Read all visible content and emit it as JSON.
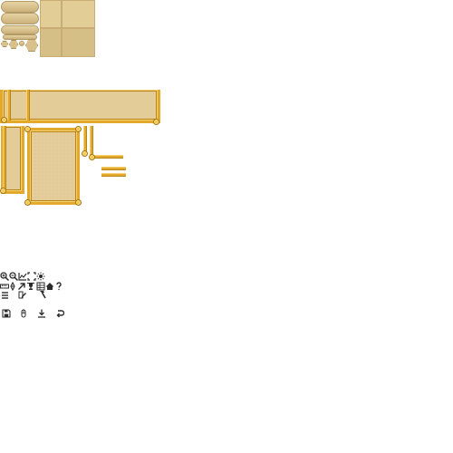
{
  "sheet": {
    "background": "#ffffff"
  },
  "palette": {
    "parchment": "#e3cc98",
    "parchment_dark": "#d6bf86",
    "gold": "#e2a92c",
    "gold_highlight": "#f5d372",
    "gold_shadow": "#b98417",
    "icon": "#2b2b2b"
  },
  "swatches": {
    "pills": 4,
    "hexes": 3,
    "tiles": [
      "light",
      "light",
      "dark",
      "dark"
    ]
  },
  "frames": [
    "panel-wide",
    "panel-tall-narrow",
    "panel-card",
    "bracket-vertical",
    "bracket-corner",
    "divider-double"
  ],
  "icons": {
    "row1": [
      "zoom-in-icon",
      "zoom-out-icon",
      "chart-icon",
      "fit-icon",
      "sun-icon"
    ],
    "row2": [
      "ruler-icon",
      "compass-icon",
      "arrow-up-right-icon",
      "trophy-icon",
      "grid-icon",
      "home-icon",
      "question-icon"
    ],
    "row3": [
      "menu-icon",
      "quill-icon",
      "hammer-icon"
    ],
    "row4": [
      "save-icon",
      "mouse-icon",
      "download-icon",
      "undo-icon"
    ]
  }
}
